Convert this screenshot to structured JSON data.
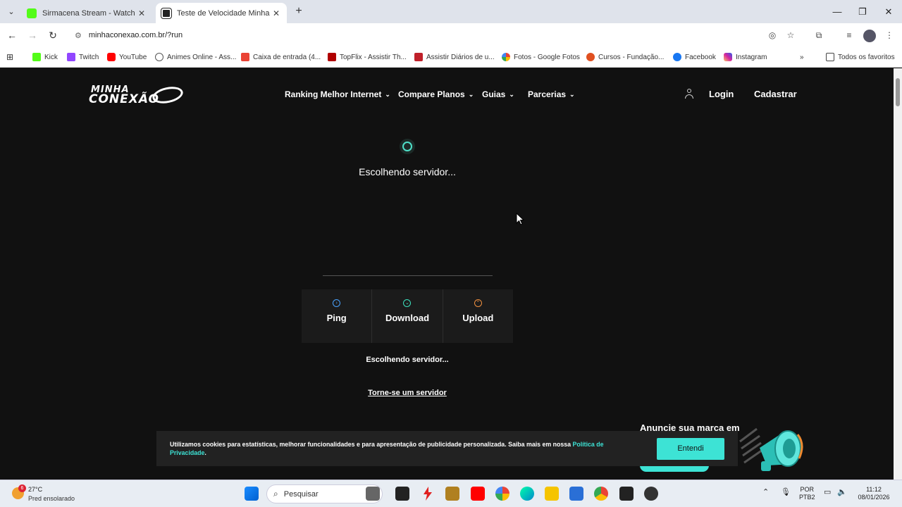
{
  "browser": {
    "tabs": [
      {
        "title": "Sirmacena Stream - Watch Live",
        "favicon_color": "#53fc18",
        "active": false
      },
      {
        "title": "Teste de Velocidade Minha Con",
        "favicon_color": "#222222",
        "active": true
      }
    ],
    "new_tab_label": "+",
    "url": "minhaconexao.com.br/?run",
    "bookmarks": [
      {
        "label": "Kick",
        "icon": "kick-icon",
        "color": "#53fc18"
      },
      {
        "label": "Twitch",
        "icon": "twitch-icon",
        "color": "#9146ff"
      },
      {
        "label": "YouTube",
        "icon": "youtube-icon",
        "color": "#ff0000"
      },
      {
        "label": "Animes Online - Ass...",
        "icon": "globe-icon",
        "color": "#555555"
      },
      {
        "label": "Caixa de entrada (4...",
        "icon": "gmail-icon",
        "color": "#ea4335"
      },
      {
        "label": "TopFlix - Assistir Th...",
        "icon": "topflix-icon",
        "color": "#b00000"
      },
      {
        "label": "Assistir Diários de u...",
        "icon": "w-icon",
        "color": "#c0202a"
      },
      {
        "label": "Fotos - Google Fotos",
        "icon": "photos-icon",
        "color": "#fbbc04"
      },
      {
        "label": "Cursos - Fundação...",
        "icon": "cursos-icon",
        "color": "#e05020"
      },
      {
        "label": "Facebook",
        "icon": "facebook-icon",
        "color": "#1877f2"
      },
      {
        "label": "Instagram",
        "icon": "instagram-icon",
        "color": "#d6249f"
      }
    ],
    "all_bookmarks_label": "Todos os favoritos"
  },
  "site": {
    "logo_line1": "MINHA",
    "logo_line2": "CONEXÃO",
    "nav": [
      {
        "label": "Ranking Melhor Internet"
      },
      {
        "label": "Compare Planos"
      },
      {
        "label": "Guias"
      },
      {
        "label": "Parcerias"
      }
    ],
    "login_label": "Login",
    "signup_label": "Cadastrar",
    "status_main": "Escolhendo servidor...",
    "metrics": [
      {
        "label": "Ping",
        "icon": "ping-icon",
        "color": "#4aa3ff"
      },
      {
        "label": "Download",
        "icon": "download-icon",
        "color": "#3de3c0"
      },
      {
        "label": "Upload",
        "icon": "upload-icon",
        "color": "#f09040"
      }
    ],
    "status_small": "Escolhendo servidor...",
    "become_server_link": "Torne-se um servidor",
    "ad_title": "Anuncie sua marca em",
    "cookie": {
      "text": "Utilizamos cookies para estatísticas, melhorar funcionalidades e para apresentação de publicidade personalizada. Saiba mais em nossa ",
      "link_text": "Política de Privacidade",
      "after_link": ".",
      "button_label": "Entendi"
    },
    "accent_color": "#3de3d5"
  },
  "taskbar": {
    "weather_badge": "6",
    "temperature": "27°C",
    "weather_desc": "Pred ensolarado",
    "search_placeholder": "Pesquisar",
    "lang_line1": "POR",
    "lang_line2": "PTB2",
    "time": "11:12",
    "date": "08/01/2026"
  }
}
